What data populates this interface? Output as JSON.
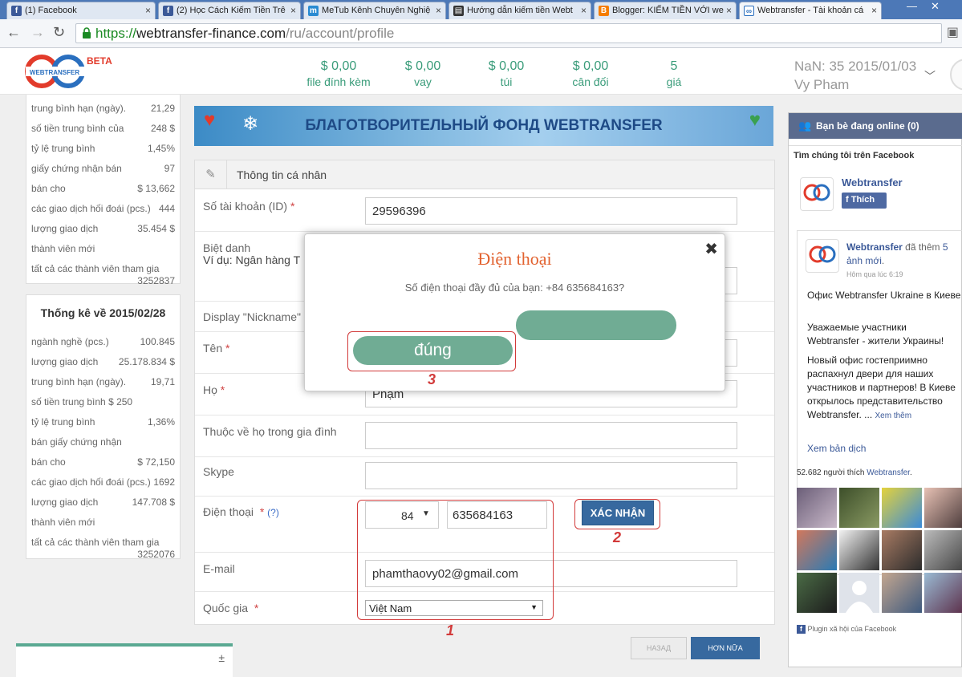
{
  "browser": {
    "tabs": [
      {
        "title": "(1) Facebook",
        "icon": "facebook-icon",
        "color": "#3b5998"
      },
      {
        "title": "(2) Học Cách Kiếm Tiền Trê",
        "icon": "facebook-icon",
        "color": "#3b5998"
      },
      {
        "title": "MeTub Kênh Chuyên Nghiệ",
        "icon": "metub-icon",
        "color": "#2a8bd2"
      },
      {
        "title": "Hướng dẫn kiếm tiền Webt",
        "icon": "film-icon",
        "color": "#333333"
      },
      {
        "title": "Blogger: KIẾM TIỀN VỚI we",
        "icon": "blogger-icon",
        "color": "#f57d00"
      },
      {
        "title": "Webtransfer - Tài khoản cá",
        "icon": "webtransfer-icon",
        "color": "#2a6fbf"
      }
    ],
    "url": {
      "scheme": "https://",
      "host": "webtransfer-finance.com",
      "path": "/ru/account/profile"
    }
  },
  "header": {
    "logo_text": "WEBTRANSFER",
    "beta": "BETA",
    "stats": [
      {
        "value": "$ 0,00",
        "label": "file đính kèm"
      },
      {
        "value": "$ 0,00",
        "label": "vay"
      },
      {
        "value": "$ 0,00",
        "label": "túi"
      },
      {
        "value": "$ 0,00",
        "label": "cân đối"
      },
      {
        "value": "5",
        "label": "giá"
      }
    ],
    "user_line1": "NaN: 35 2015/01/03",
    "user_line2": "Vy Pham"
  },
  "left": {
    "panel1": [
      {
        "k": "trung bình hạn (ngày).",
        "v": "21,29"
      },
      {
        "k": "số tiền trung bình của",
        "v": "248 $"
      },
      {
        "k": "tỷ lệ trung bình",
        "v": "1,45%"
      },
      {
        "k": "giấy chứng nhận bán",
        "v": "97"
      },
      {
        "k": "bán cho",
        "v": "$ 13,662"
      },
      {
        "k": "các giao dịch hối đoái (pcs.)",
        "v": "444"
      },
      {
        "k": "lượng giao dịch",
        "v": "35.454 $"
      },
      {
        "k": "thành viên mới",
        "v": ""
      },
      {
        "k": "tất cả các thành viên tham gia",
        "v": ""
      }
    ],
    "panel1_total": "3252837",
    "panel2_title": "Thống kê về 2015/02/28",
    "panel2": [
      {
        "k": "ngành nghề (pcs.)",
        "v": "100.845"
      },
      {
        "k": "lượng giao dịch",
        "v": "25.178.834 $"
      },
      {
        "k": "trung bình hạn (ngày).",
        "v": "19,71"
      },
      {
        "k": "số tiền trung bình $ 250",
        "v": ""
      },
      {
        "k": "tỷ lệ trung bình",
        "v": "1,36%"
      },
      {
        "k": "bán giấy chứng nhận",
        "v": ""
      },
      {
        "k": "bán cho",
        "v": "$ 72,150"
      },
      {
        "k": "các giao dịch hối đoái (pcs.)",
        "v": "1692"
      },
      {
        "k": "lượng giao dịch",
        "v": "147.708 $"
      },
      {
        "k": "thành viên mới",
        "v": ""
      },
      {
        "k": "tất cả các thành viên tham gia",
        "v": ""
      }
    ],
    "panel2_total": "3252076",
    "chat_plus": "±"
  },
  "banner": "БЛАГОТВОРИТЕЛЬНЫЙ ФОНД WEBTRANSFER",
  "form": {
    "title": "Thông tin cá nhân",
    "account_label": "Số tài khoản (ID)",
    "account_value": "29596396",
    "nickname_label": "Biệt danh",
    "nickname_hint": "Ví dụ: Ngân hàng T",
    "display_nick_label": "Display \"Nickname\"",
    "first_name_label": "Tên",
    "last_name_label": "Họ",
    "last_name_value": "Phạm",
    "family_label": "Thuộc về họ trong gia đình",
    "skype_label": "Skype",
    "phone_label": "Điện thoại",
    "phone_help": "(?)",
    "country_code": "84",
    "phone_value": "635684163",
    "confirm_button": "XÁC NHẬN",
    "email_label": "E-mail",
    "email_value": "phamthaovy02@gmail.com",
    "country_label": "Quốc gia",
    "country_value": "Việt Nam",
    "back_button": "НАЗАД",
    "next_button": "HƠN NỮA",
    "required_mark": "*"
  },
  "dialog": {
    "title": "Điện thoại",
    "message": "Số điện thoại đầy đủ của bạn: +84 635684163?",
    "yes_button": "đúng",
    "no_button": ""
  },
  "annotations": [
    "1",
    "2",
    "3"
  ],
  "right": {
    "friends_online": "Bạn bè đang online (0)",
    "fb_find": "Tìm chúng tôi trên Facebook",
    "page_name": "Webtransfer",
    "like_button": "Thích",
    "post_author": "Webtransfer",
    "post_action_pre": "đã thêm",
    "post_action_link": "5 ảnh mới",
    "post_time": "Hôm qua lúc 6:19",
    "post_line1": "Офис Webtransfer Ukraine в Киеве",
    "post_line2": "Уважаемые участники Webtransfer - жители Украины!",
    "post_line3": "Новый офис гостеприимно распахнул двери для наших участников и партнеров! В Киеве открылось представительство Webtransfer. ...",
    "see_more": "Xem thêm",
    "translate": "Xem bản dịch",
    "likes_pre": "52.682 người thích",
    "likes_link": "Webtransfer",
    "plugin": "Plugin xã hội của Facebook"
  },
  "colors": {
    "accent": "#3a9c7a",
    "dialog_title": "#e2622f",
    "button_green": "#70ac94",
    "annotation_red": "#d23a3a"
  }
}
